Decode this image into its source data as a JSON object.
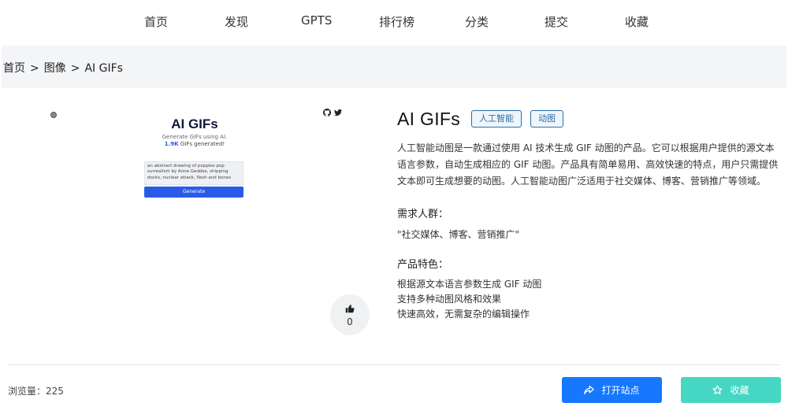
{
  "nav": {
    "items": [
      "首页",
      "发现",
      "GPTS",
      "排行榜",
      "分类",
      "提交",
      "收藏"
    ]
  },
  "breadcrumb": {
    "items": [
      "首页",
      "图像",
      "AI GIFs"
    ],
    "separator": ">"
  },
  "preview": {
    "app_title": "AI GIFs",
    "subtitle": "Generate GIFs using AI.",
    "count_value": "1.9K",
    "count_suffix": "GIFs generated!",
    "prompt_text": "an abstract drawing of poppies pop surrealism by Anne Geddes, shipping docks, nuclear attack, flesh and bones",
    "generate_label": "Generate",
    "icons": [
      "dot-icon",
      "github-icon",
      "twitter-icon"
    ]
  },
  "product": {
    "title": "AI GIFs",
    "tags": [
      "人工智能",
      "动图"
    ],
    "description": "人工智能动图是一款通过使用 AI 技术生成 GIF 动图的产品。它可以根据用户提供的源文本语言参数，自动生成相应的 GIF 动图。产品具有简单易用、高效快速的特点，用户只需提供文本即可生成想要的动图。人工智能动图广泛适用于社交媒体、博客、营销推广等领域。",
    "audience_heading": "需求人群：",
    "audience_text": "\"社交媒体、博客、营销推广\"",
    "features_heading": "产品特色：",
    "features": [
      "根据源文本语言参数生成 GIF 动图",
      "支持多种动图风格和效果",
      "快速高效，无需复杂的编辑操作"
    ]
  },
  "like": {
    "count": "0",
    "icon": "thumbs-up-icon"
  },
  "footer": {
    "views_label": "浏览量：",
    "views_count": "225",
    "open_label": "打开站点",
    "open_icon": "share-icon",
    "fav_label": "收藏",
    "fav_icon": "star-icon"
  },
  "colors": {
    "primary": "#1677ff",
    "favorite": "#45d7c3",
    "tag_border": "#2f6fa8",
    "breadcrumb_bg": "#f4f5f7"
  }
}
